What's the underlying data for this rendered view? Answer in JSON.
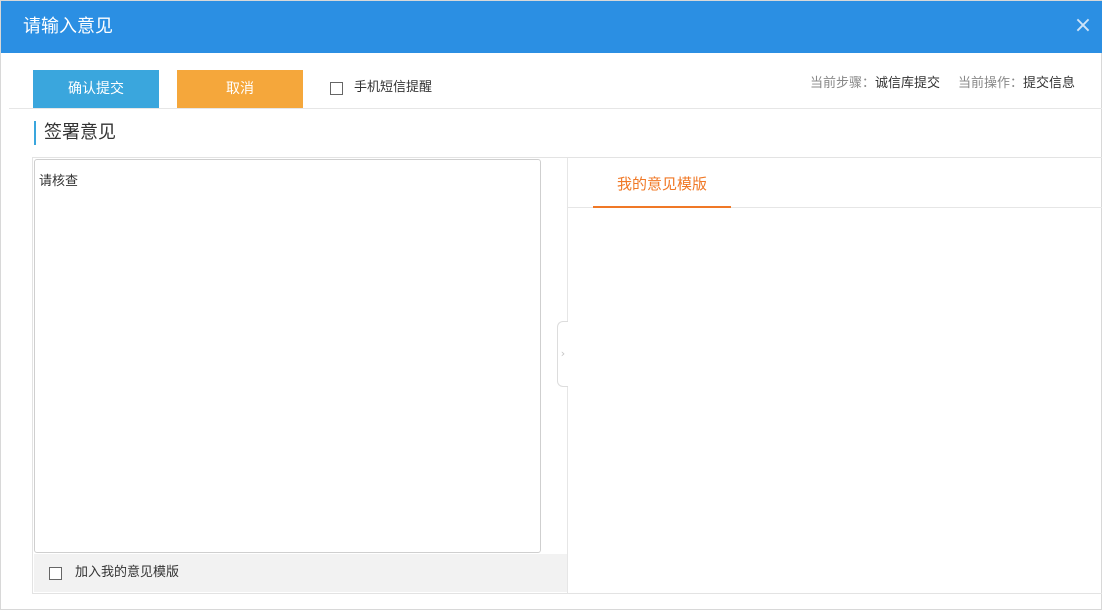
{
  "dialog": {
    "title": "请输入意见",
    "close_icon": "×"
  },
  "toolbar": {
    "confirm_label": "确认提交",
    "cancel_label": "取消",
    "sms_reminder_label": "手机短信提醒",
    "current_step_label": "当前步骤：",
    "current_step_value": "诚信库提交",
    "current_action_label": "当前操作：",
    "current_action_value": "提交信息"
  },
  "section": {
    "title": "签署意见"
  },
  "opinion": {
    "value": "请核查",
    "add_template_label": "加入我的意见模版"
  },
  "templates": {
    "tabs": [
      {
        "label": "我的意见模版",
        "active": true
      }
    ],
    "collapse_icon": "›"
  },
  "colors": {
    "title_bar": "#2b8fe3",
    "confirm_button": "#3aa6dd",
    "cancel_button": "#f5a73b",
    "active_tab": "#f07826"
  }
}
